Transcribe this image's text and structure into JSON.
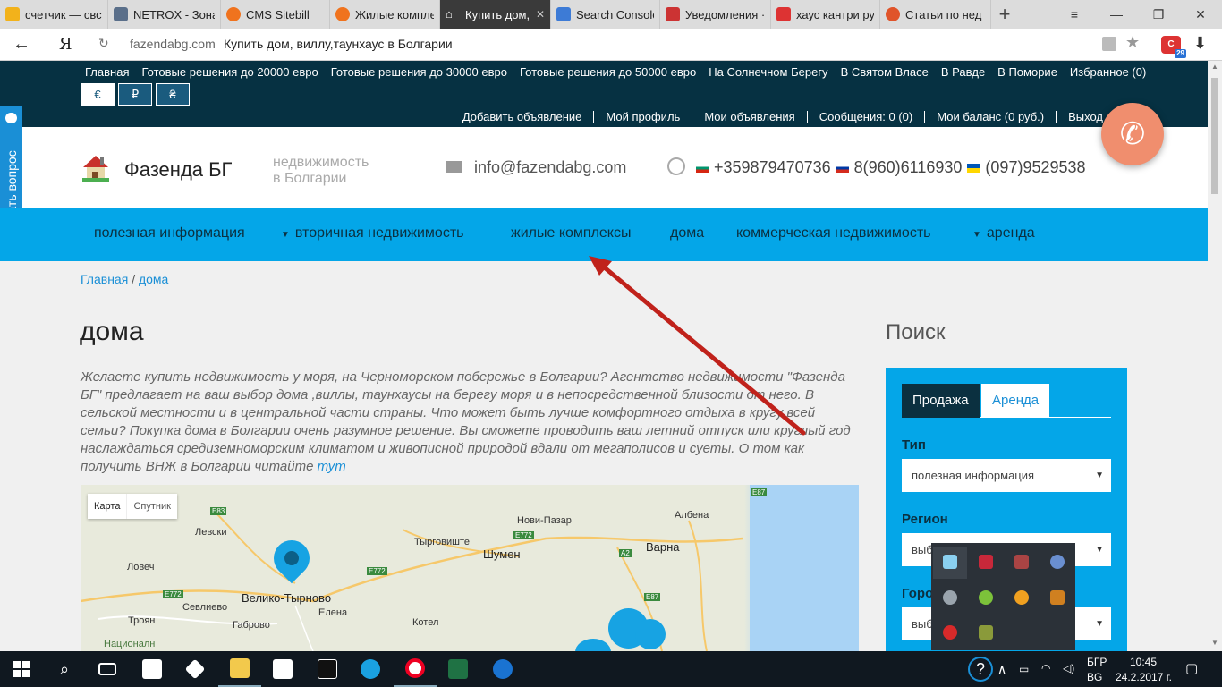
{
  "browser": {
    "tabs": [
      {
        "label": "счетчик — свс",
        "color": "#f2b21b"
      },
      {
        "label": "NETROX - Зона",
        "color": "#5a6f8a"
      },
      {
        "label": "CMS Sitebill",
        "color": "#f0731e"
      },
      {
        "label": "Жилые компле",
        "color": "#f0731e"
      },
      {
        "label": "Купить дом,",
        "color": "#ffffff"
      },
      {
        "label": "Search Console",
        "color": "#3d7bd6"
      },
      {
        "label": "Уведомления ·",
        "color": "#c33"
      },
      {
        "label": "хаус кантри ру",
        "color": "#d33"
      },
      {
        "label": "Статьи по нед",
        "color": "#e0542a"
      }
    ],
    "address": {
      "yandex_logo": "Я",
      "url": "fazendabg.com",
      "page_title": "Купить дом, виллу,таунхаус в Болгарии",
      "extension_badge": "29"
    }
  },
  "site": {
    "top_nav": [
      "Главная",
      "Готовые решения до 20000 евро",
      "Готовые решения до 30000 евро",
      "Готовые решения до 50000 евро",
      "На Солнечном Берегу",
      "В Святом Власе",
      "В Равде",
      "В Поморие",
      "Избранное (0)"
    ],
    "currencies": [
      "€",
      "₽",
      "₴"
    ],
    "user_nav": [
      "Добавить объявление",
      "Мой профиль",
      "Мои объявления",
      "Сообщения: 0 (0)",
      "Мои баланс (0 руб.)",
      "Выход"
    ],
    "brand": "Фазенда БГ",
    "tagline_line1": "недвижимость",
    "tagline_line2": "в Болгарии",
    "email": "info@fazendabg.com",
    "phones": [
      "+359879470736",
      "8(960)6116930",
      "(097)9529538"
    ],
    "side_tab": "Задать вопрос",
    "main_nav": [
      "полезная информация",
      "вторичная недвижимость",
      "жилые комплексы",
      "дома",
      "коммерческая недвижимость",
      "аренда"
    ],
    "breadcrumb": {
      "home": "Главная",
      "sep": "/",
      "current": "дома"
    },
    "page_title": "дома",
    "intro_text": "Желаете купить недвижимость у моря, на Черноморском побережье в Болгарии? Агентство недвижимости \"Фазенда БГ\" предлагает на ваш выбор дома ,виллы, таунхаусы на берегу моря и в непосредственной близости от него. В сельской местности и в центральной части страны. Что может быть лучше комфортного отдыха в кругу всей семьи? Покупка дома в Болгарии очень разумное решение. Вы сможете проводить ваш летний отпуск или круглый год наслаждаться средиземноморским климатом и живописной природой вдали от мегаполисов и суеты. О том как получить ВНЖ в Болгарии читайте ",
    "intro_link": "тут",
    "map": {
      "type_map": "Карта",
      "type_satellite": "Спутник",
      "cities": [
        "Левски",
        "Ловеч",
        "Велико-Тырново",
        "Севлиево",
        "Габрово",
        "Троян",
        "Елена",
        "Тырговиште",
        "Шумен",
        "Нови-Пазар",
        "Варна",
        "Албена",
        "Котел",
        "Националн"
      ],
      "roads": [
        "E83",
        "E772",
        "E772",
        "E772",
        "A2",
        "E87",
        "E87"
      ]
    },
    "search": {
      "heading": "Поиск",
      "tab_sale": "Продажа",
      "tab_rent": "Аренда",
      "type_label": "Тип",
      "type_value": "полезная информация",
      "region_label": "Регион",
      "region_value": "выбе",
      "city_label": "Горо",
      "city_value": "выбе"
    }
  },
  "taskbar": {
    "lang": "БГР",
    "lang2": "BG",
    "time": "10:45",
    "date": "24.2.2017 г."
  }
}
